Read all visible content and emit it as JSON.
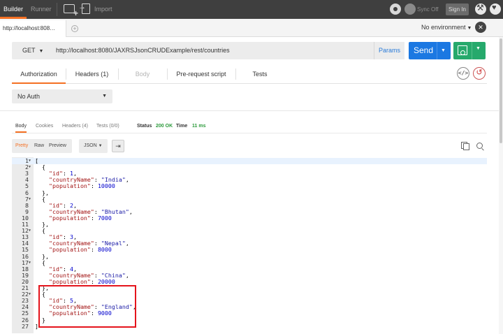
{
  "topbar": {
    "modes": [
      "Builder",
      "Runner"
    ],
    "import_label": "Import",
    "sync_label": "Sync Off",
    "sign_in_label": "Sign In"
  },
  "tabs": {
    "active_tab_title": "http://localhost:808…",
    "environment": "No environment"
  },
  "request": {
    "method": "GET",
    "url": "http://localhost:8080/JAXRSJsonCRUDExample/rest/countries",
    "params_label": "Params",
    "send_label": "Send",
    "tabs": [
      {
        "label": "Authorization"
      },
      {
        "label": "Headers (1)"
      },
      {
        "label": "Body"
      },
      {
        "label": "Pre-request script"
      },
      {
        "label": "Tests"
      }
    ],
    "auth_type": "No Auth"
  },
  "response": {
    "tabs": [
      "Body",
      "Cookies",
      "Headers (4)",
      "Tests (0/0)"
    ],
    "status_label": "Status",
    "status_value": "200 OK",
    "time_label": "Time",
    "time_value": "11 ms",
    "view_modes": [
      "Pretty",
      "Raw",
      "Preview"
    ],
    "format": "JSON",
    "lines": [
      "[",
      "  {",
      "    \"id\": 1,",
      "    \"countryName\": \"India\",",
      "    \"population\": 10000",
      "  },",
      "  {",
      "    \"id\": 2,",
      "    \"countryName\": \"Bhutan\",",
      "    \"population\": 7000",
      "  },",
      "  {",
      "    \"id\": 3,",
      "    \"countryName\": \"Nepal\",",
      "    \"population\": 8000",
      "  },",
      "  {",
      "    \"id\": 4,",
      "    \"countryName\": \"China\",",
      "    \"population\": 20000",
      "  },",
      "  {",
      "    \"id\": 5,",
      "    \"countryName\": \"England\",",
      "    \"population\": 9000",
      "  }",
      "]"
    ],
    "fold_lines": [
      1,
      2,
      7,
      12,
      17,
      22
    ]
  },
  "colors": {
    "accent_orange": "#f47023",
    "send_blue": "#1b78e2",
    "save_green": "#26a96c",
    "status_green": "#2b9a3b",
    "highlight_red": "#e5141c"
  }
}
